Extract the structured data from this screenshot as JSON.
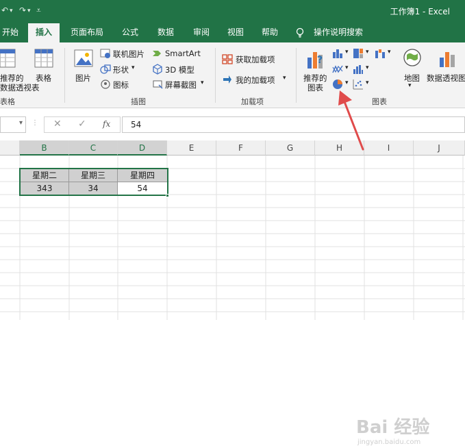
{
  "titlebar": {
    "title": "工作簿1  -  Excel",
    "undo_glyph": "↶",
    "redo_glyph": "↷",
    "customize_glyph": "⩡"
  },
  "tabs": [
    {
      "label": "开始",
      "active": false
    },
    {
      "label": "插入",
      "active": true
    },
    {
      "label": "页面布局",
      "active": false
    },
    {
      "label": "公式",
      "active": false
    },
    {
      "label": "数据",
      "active": false
    },
    {
      "label": "审阅",
      "active": false
    },
    {
      "label": "视图",
      "active": false
    },
    {
      "label": "帮助",
      "active": false
    }
  ],
  "tell_me": {
    "label": "操作说明搜索"
  },
  "ribbon": {
    "tables": {
      "pivot_line1": "推荐的",
      "pivot_line2": "数据透视表",
      "table_label": "表格",
      "group_label": "表格"
    },
    "illustrations": {
      "pictures": "图片",
      "online_pictures": "联机图片",
      "shapes": "形状",
      "icons": "图标",
      "smartart": "SmartArt",
      "model3d": "3D 模型",
      "screenshot": "屏幕截图",
      "group_label": "插图"
    },
    "addins": {
      "get_addins": "获取加载项",
      "my_addins": "我的加载项",
      "group_label": "加载项"
    },
    "charts": {
      "recommended_line1": "推荐的",
      "recommended_line2": "图表",
      "maps": "地图",
      "pivotchart": "数据透视图",
      "group_label": "图表"
    }
  },
  "formula_bar": {
    "value": "54",
    "cancel_glyph": "✕",
    "enter_glyph": "✓",
    "fx_glyph": "fx"
  },
  "columns": [
    "B",
    "C",
    "D",
    "E",
    "F",
    "G",
    "H",
    "I",
    "J"
  ],
  "table": {
    "headers": [
      "星期二",
      "星期三",
      "星期四"
    ],
    "values": [
      "343",
      "34",
      "54"
    ]
  },
  "colors": {
    "excel_green": "#217346",
    "arrow_red": "#e04b4b",
    "selection_gray": "#d0d0d0"
  },
  "watermark": {
    "text": "Bai 经验",
    "sub": "jingyan.baidu.com"
  }
}
